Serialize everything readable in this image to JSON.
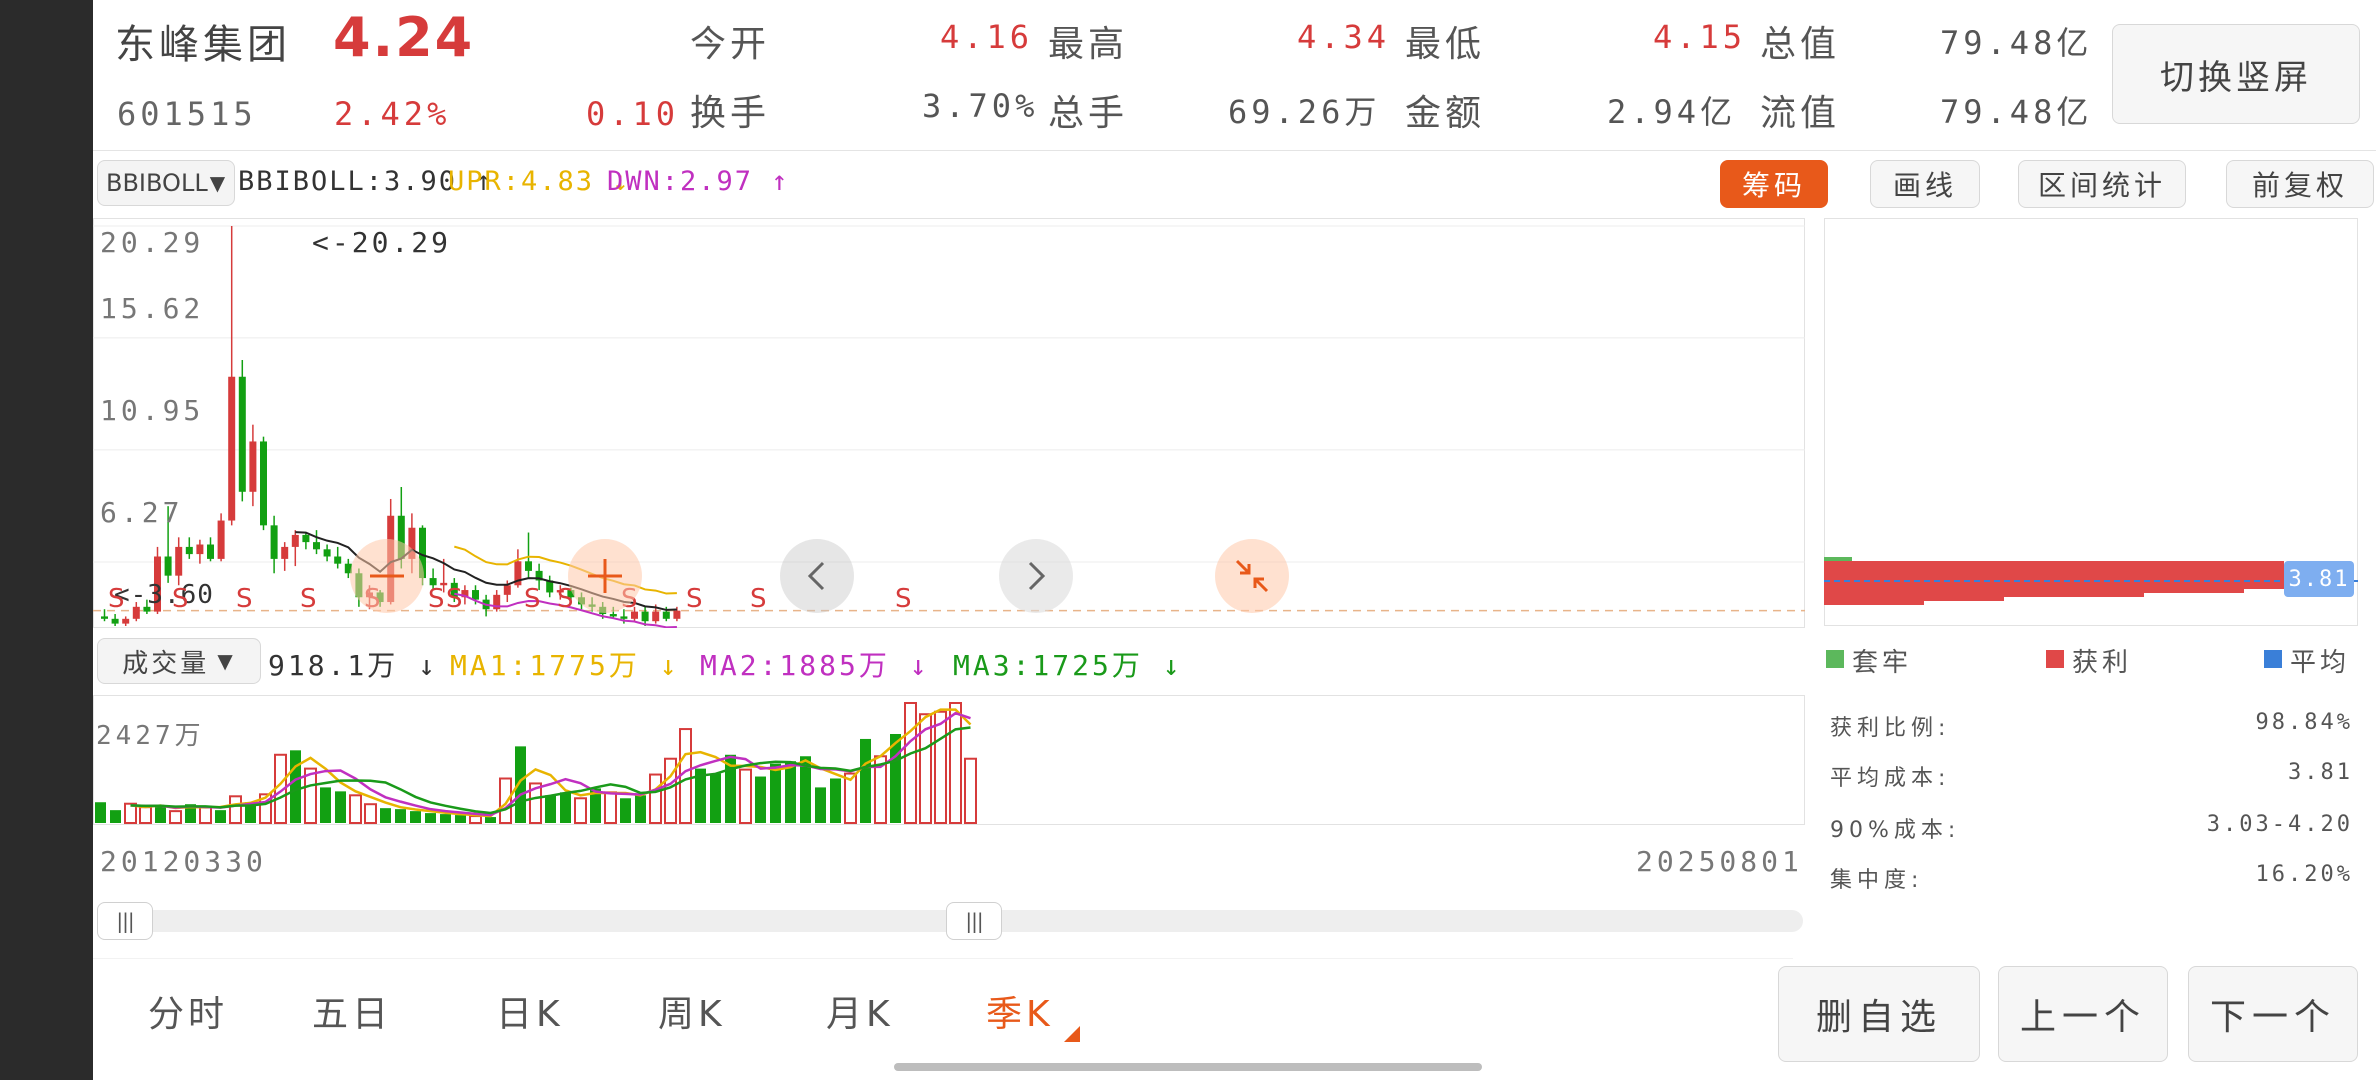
{
  "stock": {
    "name": "东峰集团",
    "price": "4.24",
    "code": "601515",
    "change_pct": "2.42%",
    "change": "0.10"
  },
  "quote": {
    "open_label": "今开",
    "open": "4.16",
    "high_label": "最高",
    "high": "4.34",
    "low_label": "最低",
    "low": "4.15",
    "mktcap_label": "总值",
    "mktcap": "79.48亿",
    "turnover_label": "换手",
    "turnover": "3.70%",
    "volume_label": "总手",
    "volume": "69.26万",
    "amount_label": "金额",
    "amount": "2.94亿",
    "float_label": "流值",
    "float": "79.48亿"
  },
  "switch_button": "切换竖屏",
  "indicator": {
    "select": "BBIBOLL",
    "bbiboll": "BBIBOLL:3.90 ↑",
    "upr": "UPR:4.83 ↓",
    "dwn": "DWN:2.97 ↑",
    "upr_color": "#e8b400",
    "dwn_color": "#c030c0"
  },
  "toolbar": {
    "chips": "筹码",
    "draw": "画线",
    "range_stats": "区间统计",
    "adjust": "前复权"
  },
  "price_axis": [
    "20.29",
    "15.62",
    "10.95",
    "6.27"
  ],
  "price_annot_high": "<-20.29",
  "price_annot_low": "<-3.60",
  "s_marks": [
    "S",
    "S",
    "S",
    "S",
    "S",
    "S",
    "S",
    "S",
    "S",
    "S",
    "S",
    "S",
    "S"
  ],
  "volume": {
    "select": "成交量",
    "value": "918.1万 ↓",
    "ma1": "MA1:1775万 ↓",
    "ma2": "MA2:1885万 ↓",
    "ma3": "MA3:1725万 ↓",
    "axis_max": "2427万",
    "ma1_color": "#e8b400",
    "ma2_color": "#c030c0",
    "ma3_color": "#1a9a1a"
  },
  "date_start": "20120330",
  "date_end": "20250801",
  "chip_panel": {
    "current_price": "3.81",
    "legend": [
      {
        "label": "套牢",
        "color": "#5cb85c"
      },
      {
        "label": "获利",
        "color": "#e04848"
      },
      {
        "label": "平均",
        "color": "#3a7fd8"
      }
    ],
    "stats": [
      {
        "label": "获利比例:",
        "value": "98.84%"
      },
      {
        "label": "平均成本:",
        "value": "3.81"
      },
      {
        "label": "90%成本:",
        "value": "3.03-4.20"
      },
      {
        "label": "集中度:",
        "value": "16.20%"
      }
    ]
  },
  "period_tabs": [
    "分时",
    "五日",
    "日K",
    "周K",
    "月K",
    "季K"
  ],
  "active_tab": "季K",
  "actions": {
    "remove_watch": "删自选",
    "prev": "上一个",
    "next": "下一个"
  },
  "accent_color": "#e8591a",
  "up_color": "#d63b3b",
  "down_color": "#12a012",
  "chart_data": [
    {
      "type": "candlestick",
      "ylim": [
        3.6,
        20.29
      ],
      "ticks": [
        20.29,
        15.62,
        10.95,
        6.27
      ],
      "period": "quarterly",
      "candles": [
        {
          "o": 4.0,
          "h": 4.3,
          "l": 3.8,
          "c": 3.9
        },
        {
          "o": 3.9,
          "h": 4.1,
          "l": 3.6,
          "c": 3.7
        },
        {
          "o": 3.7,
          "h": 4.0,
          "l": 3.6,
          "c": 3.9
        },
        {
          "o": 3.9,
          "h": 4.6,
          "l": 3.8,
          "c": 4.4
        },
        {
          "o": 4.4,
          "h": 4.7,
          "l": 4.1,
          "c": 4.2
        },
        {
          "o": 4.2,
          "h": 6.9,
          "l": 4.1,
          "c": 6.5
        },
        {
          "o": 6.5,
          "h": 8.6,
          "l": 5.4,
          "c": 5.7
        },
        {
          "o": 5.7,
          "h": 7.3,
          "l": 5.3,
          "c": 6.9
        },
        {
          "o": 6.9,
          "h": 7.3,
          "l": 6.4,
          "c": 6.6
        },
        {
          "o": 6.6,
          "h": 7.2,
          "l": 6.2,
          "c": 7.0
        },
        {
          "o": 7.0,
          "h": 7.3,
          "l": 6.3,
          "c": 6.4
        },
        {
          "o": 6.4,
          "h": 8.3,
          "l": 6.3,
          "c": 8.0
        },
        {
          "o": 8.0,
          "h": 20.29,
          "l": 7.8,
          "c": 14.0
        },
        {
          "o": 14.0,
          "h": 14.7,
          "l": 8.8,
          "c": 9.2
        },
        {
          "o": 9.2,
          "h": 12.0,
          "l": 8.6,
          "c": 11.3
        },
        {
          "o": 11.3,
          "h": 11.5,
          "l": 7.6,
          "c": 7.8
        },
        {
          "o": 7.8,
          "h": 8.2,
          "l": 5.8,
          "c": 6.4
        },
        {
          "o": 6.4,
          "h": 7.1,
          "l": 5.9,
          "c": 6.9
        },
        {
          "o": 6.9,
          "h": 7.6,
          "l": 6.1,
          "c": 7.4
        },
        {
          "o": 7.4,
          "h": 7.5,
          "l": 6.8,
          "c": 7.1
        },
        {
          "o": 7.1,
          "h": 7.6,
          "l": 6.6,
          "c": 6.8
        },
        {
          "o": 6.8,
          "h": 7.0,
          "l": 6.3,
          "c": 6.5
        },
        {
          "o": 6.5,
          "h": 6.9,
          "l": 6.0,
          "c": 6.2
        },
        {
          "o": 6.2,
          "h": 6.4,
          "l": 5.6,
          "c": 5.8
        },
        {
          "o": 5.8,
          "h": 6.0,
          "l": 4.4,
          "c": 4.8
        },
        {
          "o": 4.8,
          "h": 5.3,
          "l": 4.3,
          "c": 5.0
        },
        {
          "o": 5.0,
          "h": 5.1,
          "l": 4.4,
          "c": 4.6
        },
        {
          "o": 4.6,
          "h": 8.9,
          "l": 4.5,
          "c": 8.2
        },
        {
          "o": 8.2,
          "h": 9.4,
          "l": 6.0,
          "c": 6.4
        },
        {
          "o": 6.4,
          "h": 8.3,
          "l": 5.8,
          "c": 7.7
        },
        {
          "o": 7.7,
          "h": 7.8,
          "l": 5.3,
          "c": 5.6
        },
        {
          "o": 5.6,
          "h": 6.0,
          "l": 5.1,
          "c": 5.3
        },
        {
          "o": 5.3,
          "h": 6.4,
          "l": 5.0,
          "c": 5.4
        },
        {
          "o": 5.4,
          "h": 5.6,
          "l": 4.6,
          "c": 4.8
        },
        {
          "o": 4.8,
          "h": 5.3,
          "l": 4.5,
          "c": 5.1
        },
        {
          "o": 5.1,
          "h": 5.3,
          "l": 4.5,
          "c": 4.7
        },
        {
          "o": 4.7,
          "h": 4.9,
          "l": 4.0,
          "c": 4.3
        },
        {
          "o": 4.3,
          "h": 5.1,
          "l": 4.2,
          "c": 4.9
        },
        {
          "o": 4.9,
          "h": 5.5,
          "l": 4.6,
          "c": 5.3
        },
        {
          "o": 5.3,
          "h": 6.8,
          "l": 5.2,
          "c": 6.3
        },
        {
          "o": 6.3,
          "h": 7.5,
          "l": 5.6,
          "c": 5.9
        },
        {
          "o": 5.9,
          "h": 6.2,
          "l": 5.1,
          "c": 5.5
        },
        {
          "o": 5.5,
          "h": 5.7,
          "l": 4.8,
          "c": 5.0
        },
        {
          "o": 5.0,
          "h": 5.3,
          "l": 4.7,
          "c": 5.1
        },
        {
          "o": 5.1,
          "h": 5.2,
          "l": 4.6,
          "c": 4.8
        },
        {
          "o": 4.8,
          "h": 5.0,
          "l": 4.3,
          "c": 4.5
        },
        {
          "o": 4.5,
          "h": 4.8,
          "l": 4.2,
          "c": 4.4
        },
        {
          "o": 4.4,
          "h": 4.6,
          "l": 3.9,
          "c": 4.1
        },
        {
          "o": 4.1,
          "h": 4.4,
          "l": 3.9,
          "c": 4.0
        },
        {
          "o": 4.0,
          "h": 4.3,
          "l": 3.7,
          "c": 3.9
        },
        {
          "o": 3.9,
          "h": 4.4,
          "l": 3.8,
          "c": 4.2
        },
        {
          "o": 4.2,
          "h": 4.4,
          "l": 3.6,
          "c": 3.8
        },
        {
          "o": 3.8,
          "h": 4.5,
          "l": 3.7,
          "c": 4.2
        },
        {
          "o": 4.2,
          "h": 4.4,
          "l": 3.8,
          "c": 3.9
        },
        {
          "o": 3.9,
          "h": 4.4,
          "l": 3.8,
          "c": 4.24
        }
      ]
    },
    {
      "type": "bar",
      "ylim": [
        0,
        2427
      ],
      "series_name": "成交量",
      "values": [
        420,
        260,
        390,
        320,
        350,
        240,
        380,
        330,
        260,
        540,
        420,
        580,
        1380,
        1470,
        1100,
        720,
        640,
        560,
        380,
        300,
        280,
        240,
        200,
        180,
        160,
        140,
        120,
        900,
        1550,
        800,
        560,
        620,
        500,
        700,
        620,
        500,
        560,
        980,
        1300,
        1900,
        1100,
        1000,
        1380,
        1080,
        940,
        1200,
        1250,
        1350,
        720,
        900,
        1000,
        1700,
        1350,
        1800,
        2427,
        2200,
        2250,
        2427,
        1300
      ]
    }
  ]
}
